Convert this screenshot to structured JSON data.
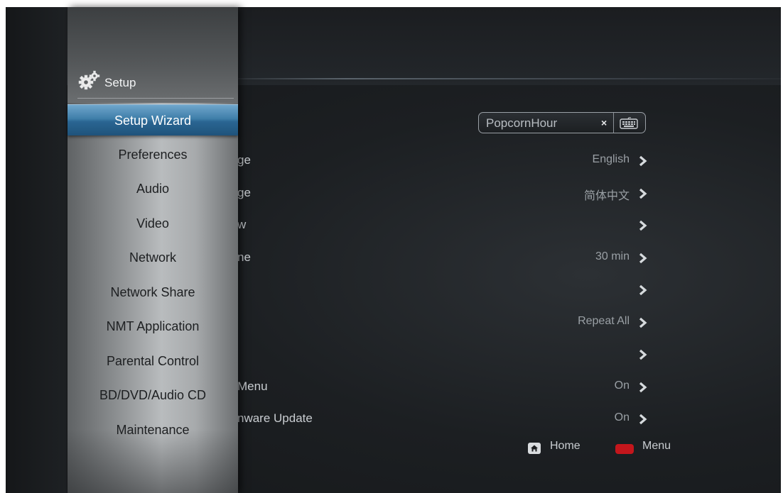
{
  "sidebar": {
    "title": "Setup",
    "items": [
      {
        "label": "Setup Wizard",
        "active": true
      },
      {
        "label": "Preferences"
      },
      {
        "label": "Audio"
      },
      {
        "label": "Video"
      },
      {
        "label": "Network"
      },
      {
        "label": "Network Share"
      },
      {
        "label": "NMT Application"
      },
      {
        "label": "Parental Control"
      },
      {
        "label": "BD/DVD/Audio CD"
      },
      {
        "label": "Maintenance"
      }
    ]
  },
  "content": {
    "name_field": {
      "value": "PopcornHour",
      "clear_icon": "×",
      "keyboard_icon": "keyboard-icon"
    },
    "rows": [
      {
        "label": "ge",
        "value": "English"
      },
      {
        "label": "ge",
        "value": "简体中文"
      },
      {
        "label": "w",
        "value": ""
      },
      {
        "label": "ne",
        "value": "30 min"
      },
      {
        "label": "",
        "value": ""
      },
      {
        "label": "",
        "value": "Repeat All"
      },
      {
        "label": "",
        "value": ""
      },
      {
        "label": "Menu",
        "value": "On"
      },
      {
        "label": "nware Update",
        "value": "On"
      }
    ]
  },
  "footer": {
    "home_label": "Home",
    "menu_label": "Menu",
    "menu_color": "#c4161c"
  }
}
